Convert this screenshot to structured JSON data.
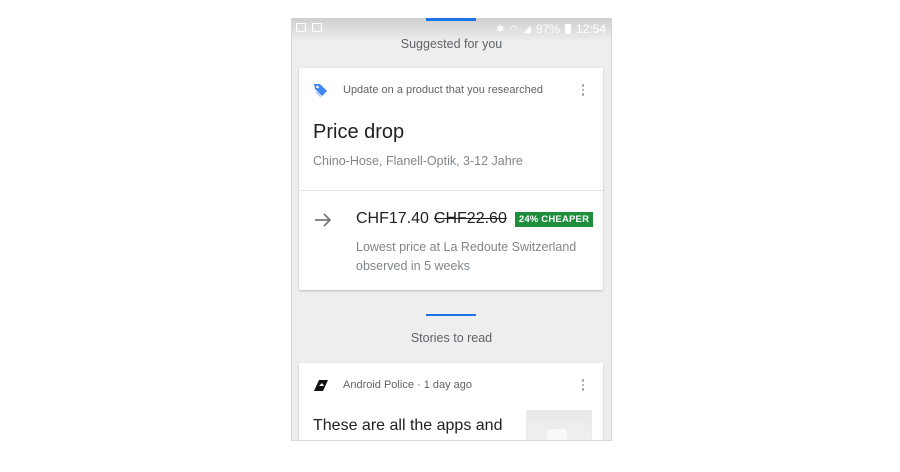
{
  "status_bar": {
    "battery": "97%",
    "time": "12:54"
  },
  "suggested": {
    "section_title": "Suggested for you",
    "card": {
      "header": "Update on a product that you researched",
      "title": "Price drop",
      "product": "Chino-Hose, Flanell-Optik, 3-12 Jahre",
      "price_new": "CHF17.40",
      "price_old": "CHF22.60",
      "badge": "24% CHEAPER",
      "info_line1": "Lowest price at La Redoute Switzerland",
      "info_line2": "observed in 5 weeks"
    }
  },
  "stories": {
    "section_title": "Stories to read",
    "card": {
      "source": "Android Police · 1 day ago",
      "title": "These are all the apps and"
    }
  },
  "colors": {
    "accent": "#1a73e8",
    "badge_green": "#1e8e3e",
    "background": "#eeeeee"
  },
  "icons": [
    "tag-icon",
    "arrow-right-icon",
    "android-police-icon",
    "more-vert-icon"
  ]
}
